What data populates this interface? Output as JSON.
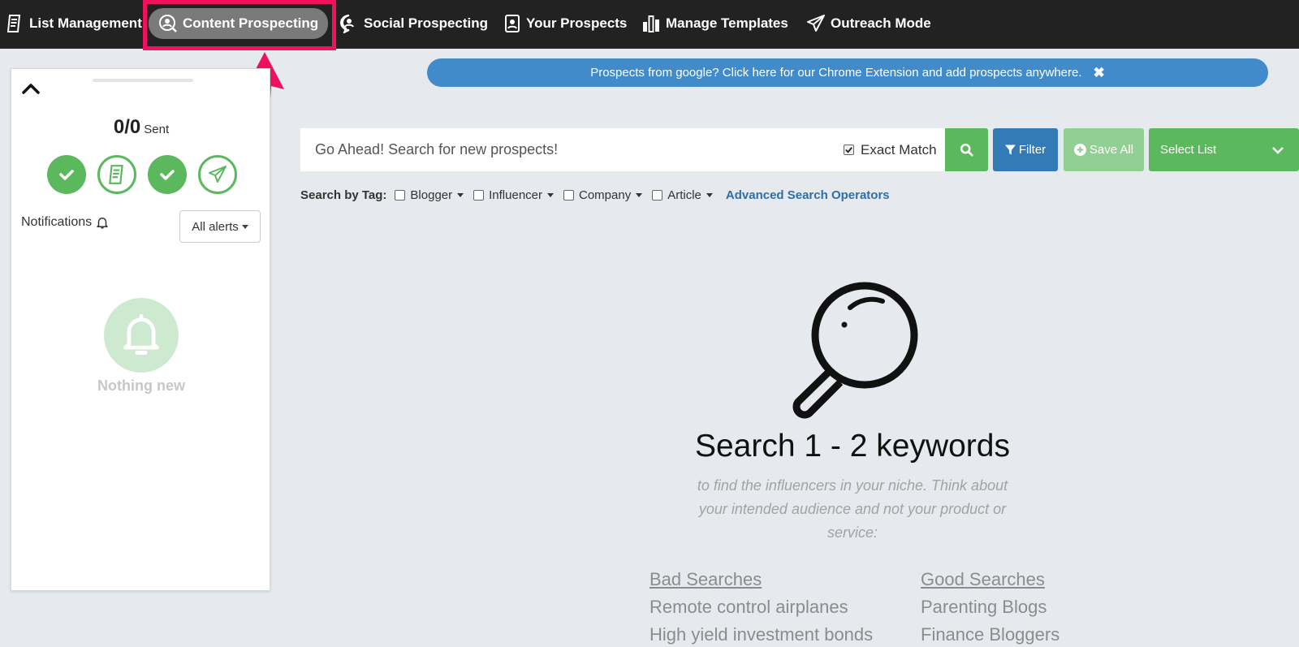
{
  "nav": {
    "items": [
      {
        "label": "List Management",
        "icon": "list-icon"
      },
      {
        "label": "Content Prospecting",
        "icon": "user-search-icon",
        "active": true
      },
      {
        "label": "Social Prospecting",
        "icon": "chat-user-icon"
      },
      {
        "label": "Your Prospects",
        "icon": "contact-card-icon"
      },
      {
        "label": "Manage Templates",
        "icon": "bars-icon"
      },
      {
        "label": "Outreach Mode",
        "icon": "paper-plane-icon"
      }
    ],
    "highlight_color": "#f0115e"
  },
  "sidebar": {
    "sent_count": "0/0",
    "sent_label": "Sent",
    "notifications_label": "Notifications",
    "alerts_button": "All alerts",
    "empty_text": "Nothing new"
  },
  "banner": {
    "text": "Prospects from google? Click here for our Chrome Extension and add prospects anywhere.",
    "close": "✖"
  },
  "search": {
    "placeholder": "Go Ahead! Search for new prospects!",
    "exact_match_label": "Exact Match",
    "exact_match_checked": true,
    "filter_label": "Filter",
    "save_all_label": "Save All",
    "select_list_label": "Select List"
  },
  "tags": {
    "label": "Search by Tag:",
    "items": [
      "Blogger",
      "Influencer",
      "Company",
      "Article"
    ],
    "advanced_link": "Advanced Search Operators"
  },
  "hero": {
    "title": "Search 1 - 2 keywords",
    "subtitle": "to find the influencers in your niche. Think about your intended audience and not your product or service:",
    "bad": {
      "heading": "Bad Searches",
      "items": [
        "Remote control airplanes",
        "High yield investment bonds"
      ]
    },
    "good": {
      "heading": "Good Searches",
      "items": [
        "Parenting Blogs",
        "Finance Bloggers"
      ]
    }
  },
  "colors": {
    "green": "#5cb85c",
    "blue": "#337ab7",
    "banner_blue": "#428bca",
    "nav_bg": "#222222"
  }
}
